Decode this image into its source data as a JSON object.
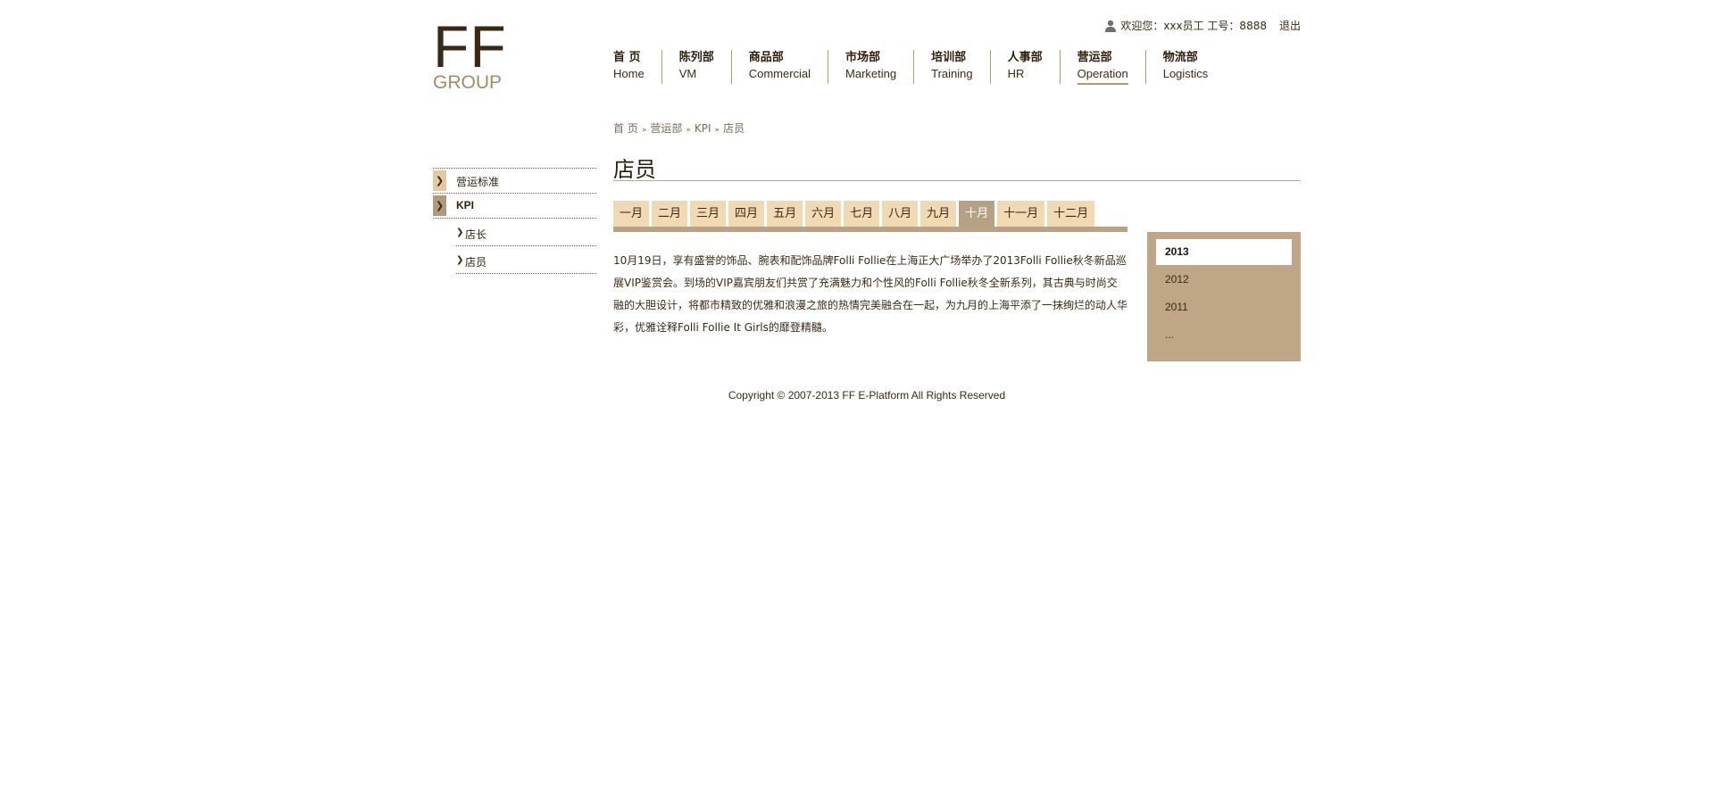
{
  "logo": {
    "line1": "FF",
    "line2": "GROUP"
  },
  "userbar": {
    "icon": "user-icon",
    "greeting": "欢迎您：xxx员工  工号：8888",
    "logout": "退出"
  },
  "nav": [
    {
      "zh": "首 页",
      "en": "Home"
    },
    {
      "zh": "陈列部",
      "en": "VM"
    },
    {
      "zh": "商品部",
      "en": "Commercial"
    },
    {
      "zh": "市场部",
      "en": "Marketing"
    },
    {
      "zh": "培训部",
      "en": "Training"
    },
    {
      "zh": "人事部",
      "en": "HR"
    },
    {
      "zh": "营运部",
      "en": "Operation",
      "active": true
    },
    {
      "zh": "物流部",
      "en": "Logistics"
    }
  ],
  "breadcrumb": [
    "首 页",
    "营运部",
    "KPI",
    "店员"
  ],
  "breadcrumb_sep": "»",
  "sidebar": {
    "marker": "❯",
    "items": [
      {
        "label": "营运标准"
      },
      {
        "label": "KPI",
        "active": true
      }
    ],
    "sub_arrow": "❯",
    "subitems": [
      {
        "label": "店长"
      },
      {
        "label": "店员"
      }
    ]
  },
  "page_title": "店员",
  "months": [
    "一月",
    "二月",
    "三月",
    "四月",
    "五月",
    "六月",
    "七月",
    "八月",
    "九月",
    "十月",
    "十一月",
    "十二月"
  ],
  "active_month_index": 9,
  "article": "10月19日，享有盛誉的饰品、腕表和配饰品牌Folli Follie在上海正大广场举办了2013Folli Follie秋冬新品巡展VIP鉴赏会。到场的VIP嘉宾朋友们共赏了充满魅力和个性风的Folli Follie秋冬全新系列，其古典与时尚交融的大胆设计，将都市精致的优雅和浪漫之旅的热情完美融合在一起，为九月的上海平添了一抹绚烂的动人华彩，优雅诠释Folli Follie It Girls的靡登精髓。",
  "years": [
    "2013",
    "2012",
    "2011",
    "..."
  ],
  "active_year_index": 0,
  "copyright": "Copyright © 2007-2013 FF E-Platform All Rights Reserved",
  "colors": {
    "accent": "#b69b6a",
    "tab": "#f0d9b3",
    "tab_active": "#b5a184",
    "year_panel": "#bfa687",
    "text": "#3a2a12"
  }
}
